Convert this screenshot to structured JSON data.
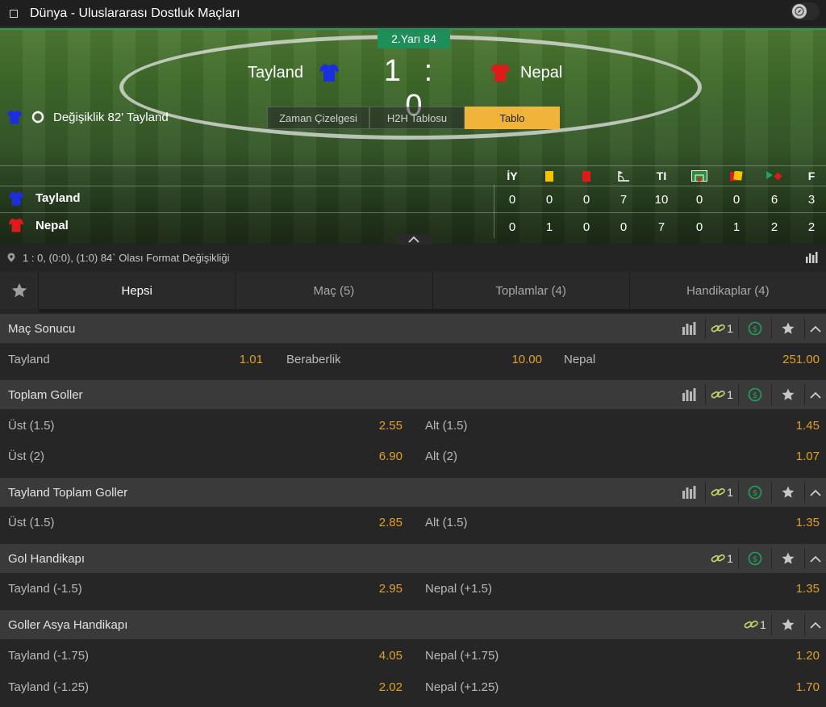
{
  "header": {
    "title": "Dünya - Uluslararası Dostluk Maçları"
  },
  "match": {
    "period": "2.Yarı 84",
    "home": "Tayland",
    "away": "Nepal",
    "home_score": "1",
    "separator": ":",
    "away_score": "0",
    "home_color": "#1b2fe0",
    "away_color": "#e01a1a",
    "last_event": "Değişiklik 82' Tayland"
  },
  "view_tabs": [
    "Zaman Çizelgesi",
    "H2H Tablosu",
    "Tablo"
  ],
  "stats": {
    "headers": [
      "İY",
      "yellow-card-icon",
      "red-card-icon",
      "corner-icon",
      "TI",
      "penalty-area-icon",
      "substitution-icon",
      "free-kick-icon",
      "F"
    ],
    "header_text": {
      "iy": "İY",
      "ti": "TI",
      "f": "F"
    },
    "home_name": "Tayland",
    "away_name": "Nepal",
    "home": [
      "0",
      "0",
      "0",
      "7",
      "10",
      "0",
      "0",
      "6",
      "3"
    ],
    "away": [
      "0",
      "1",
      "0",
      "0",
      "7",
      "0",
      "1",
      "2",
      "2"
    ]
  },
  "info_bar": {
    "text": "1 : 0, (0:0), (1:0) 84` Olası Format Değişikliği"
  },
  "market_tabs": [
    "Hepsi",
    "Maç (5)",
    "Toplamlar (4)",
    "Handikaplar (4)"
  ],
  "markets": {
    "m1": {
      "title": "Maç Sonucu",
      "link_count": "1",
      "labels": [
        "Tayland",
        "Beraberlik",
        "Nepal"
      ],
      "odds": [
        "1.01",
        "10.00",
        "251.00"
      ]
    },
    "m2": {
      "title": "Toplam Goller",
      "link_count": "1",
      "r1": {
        "l": "Üst (1.5)",
        "lo": "2.55",
        "r": "Alt (1.5)",
        "ro": "1.45"
      },
      "r2": {
        "l": "Üst (2)",
        "lo": "6.90",
        "r": "Alt (2)",
        "ro": "1.07"
      }
    },
    "m3": {
      "title": "Tayland Toplam Goller",
      "link_count": "1",
      "r1": {
        "l": "Üst (1.5)",
        "lo": "2.85",
        "r": "Alt (1.5)",
        "ro": "1.35"
      }
    },
    "m4": {
      "title": "Gol Handikapı",
      "link_count": "1",
      "r1": {
        "l": "Tayland (-1.5)",
        "lo": "2.95",
        "r": "Nepal (+1.5)",
        "ro": "1.35"
      }
    },
    "m5": {
      "title": "Goller Asya Handikapı",
      "link_count": "1",
      "r1": {
        "l": "Tayland (-1.75)",
        "lo": "4.05",
        "r": "Nepal (+1.75)",
        "ro": "1.20"
      },
      "r2": {
        "l": "Tayland (-1.25)",
        "lo": "2.02",
        "r": "Nepal (+1.25)",
        "ro": "1.70"
      }
    }
  },
  "colors": {
    "accent": "#f1b43a",
    "odds": "#e0a028",
    "period_badge": "#1f8f5a",
    "link_icon": "#b7d46a",
    "cash_icon": "#1fa35a"
  }
}
